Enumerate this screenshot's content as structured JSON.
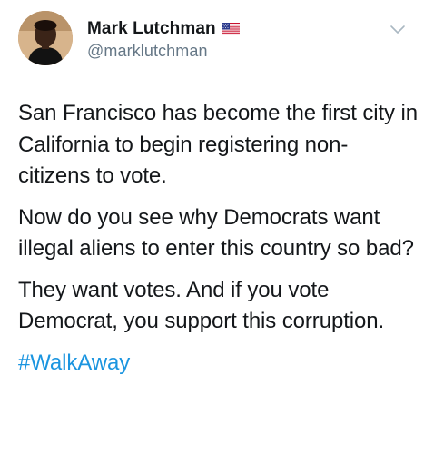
{
  "author": {
    "display_name": "Mark Lutchman",
    "handle": "@marklutchman",
    "avatar_icon": "avatar-photo",
    "flag_icon": "us-flag-icon"
  },
  "menu": {
    "icon": "chevron-down-icon"
  },
  "tweet": {
    "paragraphs": [
      "San Francisco has become the first city in California to begin registering non-citizens to vote.",
      "Now do you see why Democrats want illegal aliens to enter this country so bad?",
      "They want votes. And if you vote Democrat, you support this corruption."
    ],
    "hashtag": "#WalkAway"
  },
  "colors": {
    "text": "#14171a",
    "secondary": "#657786",
    "link": "#1b95e0",
    "background": "#ffffff"
  }
}
